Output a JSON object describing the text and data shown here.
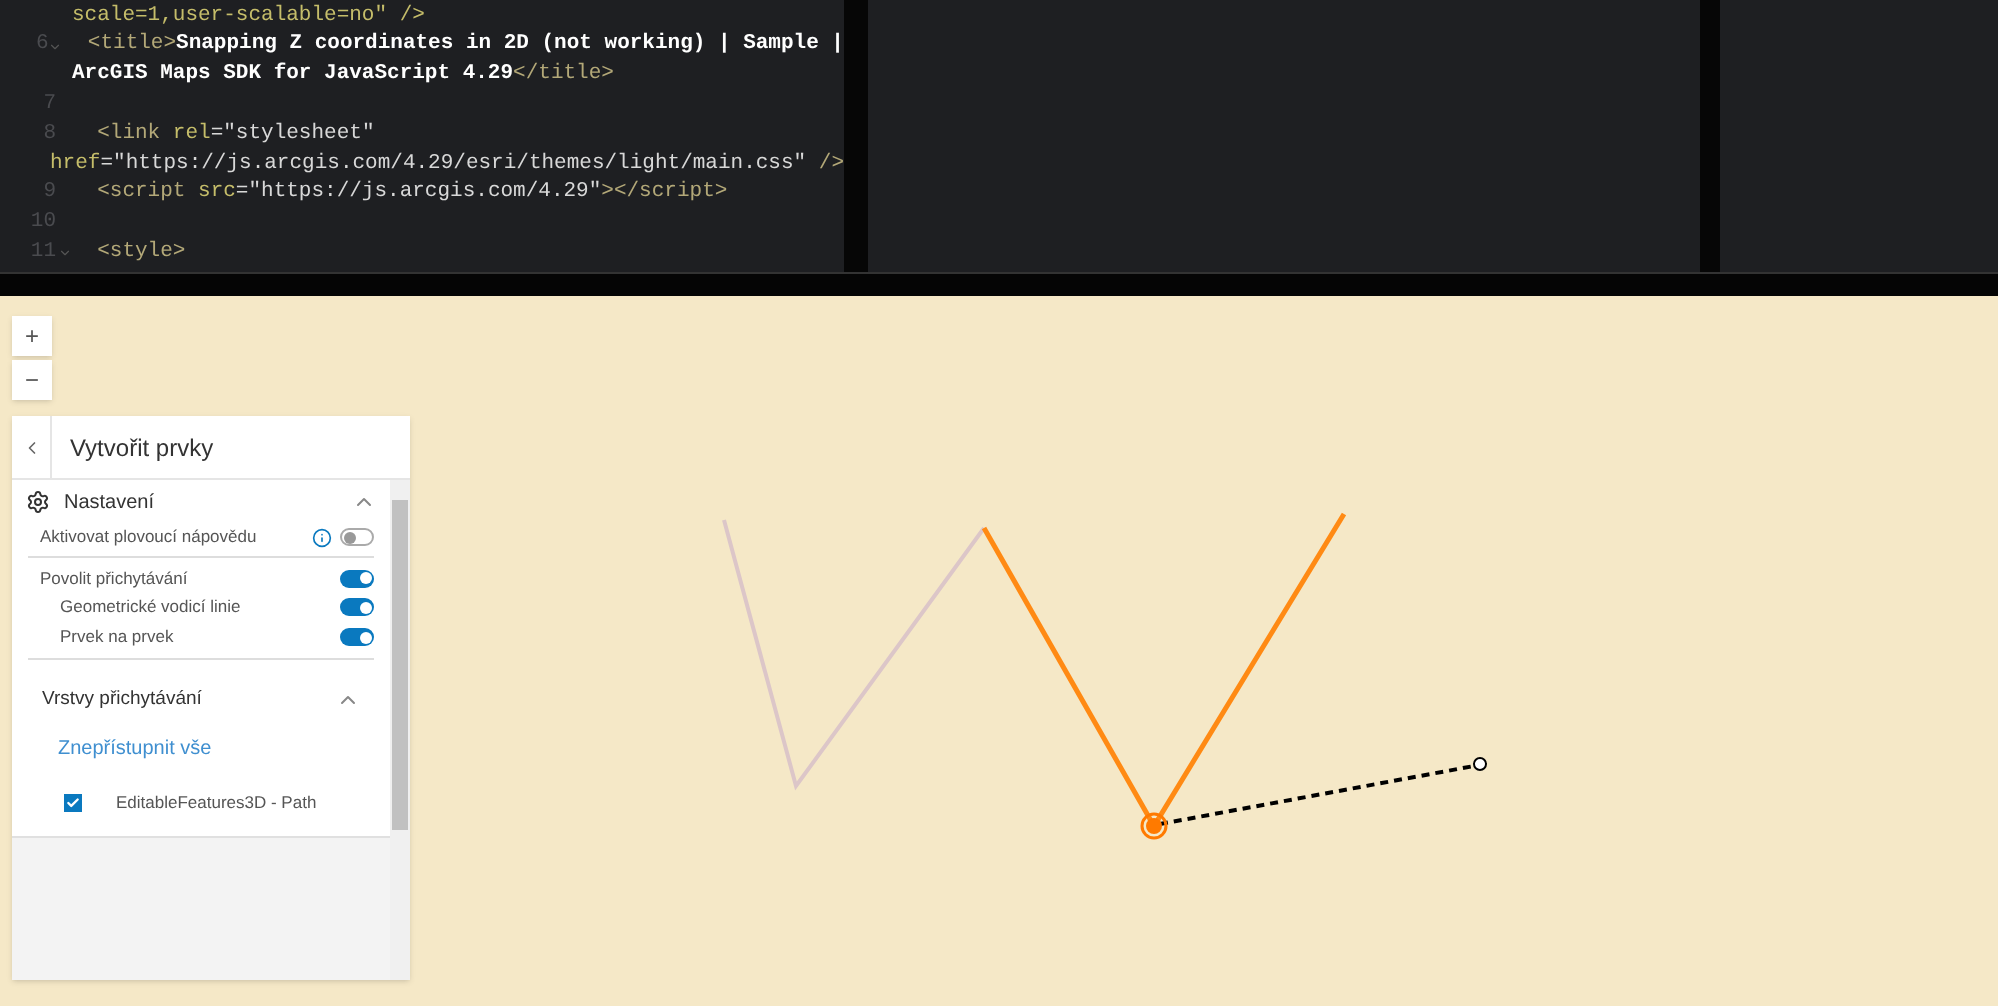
{
  "editor": {
    "lines": [
      {
        "fold": false,
        "parts": [
          {
            "kind": "attr",
            "text": "scale=1,user-scalable=no\" />"
          }
        ]
      },
      {
        "number": "6",
        "fold": true,
        "parts": [
          {
            "kind": "tag",
            "text": "  <title>"
          },
          {
            "kind": "text",
            "text": "Snapping Z coordinates in 2D (not working) | Sample |"
          }
        ]
      },
      {
        "fold": false,
        "parts": [
          {
            "kind": "text",
            "text": "ArcGIS Maps SDK for JavaScript 4.29"
          },
          {
            "kind": "tag",
            "text": "</title>"
          }
        ]
      },
      {
        "number": "7",
        "fold": false
      },
      {
        "number": "8",
        "fold": false,
        "parts": [
          {
            "kind": "tag",
            "text": "  <link "
          },
          {
            "kind": "attr",
            "text": "rel"
          },
          {
            "kind": "string",
            "text": "=\"stylesheet\""
          }
        ]
      },
      {
        "fold": false,
        "parts": [
          {
            "kind": "attr",
            "text": "href"
          },
          {
            "kind": "string",
            "text": "=\"https://js.arcgis.com/4.29/esri/themes/light/main.css\" "
          },
          {
            "kind": "tag",
            "text": "/>"
          }
        ]
      },
      {
        "number": "9",
        "fold": false,
        "parts": [
          {
            "kind": "tag",
            "text": "  <script "
          },
          {
            "kind": "attr",
            "text": "src"
          },
          {
            "kind": "string",
            "text": "=\"https://js.arcgis.com/4.29\""
          },
          {
            "kind": "tag",
            "text": "></script>"
          }
        ]
      },
      {
        "number": "10",
        "fold": false
      },
      {
        "number": "11",
        "fold": true,
        "parts": [
          {
            "kind": "tag",
            "text": "  <style>"
          }
        ]
      }
    ]
  },
  "map": {
    "zoom_buttons": [
      "+",
      "−"
    ]
  },
  "panel": {
    "title": "Vytvořit prvky",
    "settings": {
      "title": "Nastavení",
      "expanded": true,
      "tooltip_toggle": {
        "label": "Aktivovat plovoucí nápovědu",
        "on": false
      },
      "snapping": {
        "label": "Povolit přichytávání",
        "on": true,
        "children": [
          {
            "label": "Geometrické vodicí linie",
            "on": true
          },
          {
            "label": "Prvek na prvek",
            "on": true
          }
        ]
      }
    },
    "layers": {
      "title": "Vrstvy přichytávání",
      "expanded": true,
      "link": "Znepřístupnit vše",
      "items": [
        {
          "label": "EditableFeatures3D - Path",
          "checked": true
        }
      ]
    }
  }
}
